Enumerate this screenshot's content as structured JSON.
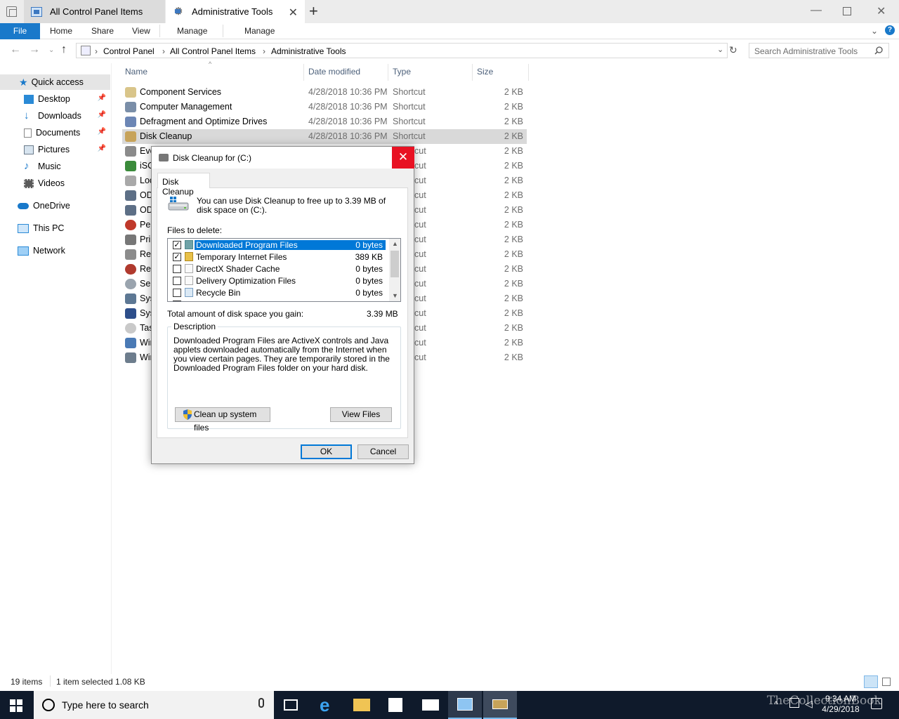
{
  "window": {
    "tabs": [
      {
        "label": "All Control Panel Items"
      },
      {
        "label": "Administrative Tools"
      }
    ]
  },
  "ribbon": {
    "file": "File",
    "tabs": [
      "Home",
      "Share",
      "View",
      "Manage",
      "Manage"
    ]
  },
  "address": {
    "crumbs": [
      "Control Panel",
      "All Control Panel Items",
      "Administrative Tools"
    ],
    "search_placeholder": "Search Administrative Tools"
  },
  "nav": {
    "items": [
      {
        "label": "Quick access",
        "icon": "star-icon"
      },
      {
        "label": "Desktop",
        "icon": "desktop-icon"
      },
      {
        "label": "Downloads",
        "icon": "download-icon"
      },
      {
        "label": "Documents",
        "icon": "documents-icon"
      },
      {
        "label": "Pictures",
        "icon": "pictures-icon"
      },
      {
        "label": "Music",
        "icon": "music-icon"
      },
      {
        "label": "Videos",
        "icon": "videos-icon"
      },
      {
        "label": "OneDrive",
        "icon": "cloud-icon"
      },
      {
        "label": "This PC",
        "icon": "computer-icon"
      },
      {
        "label": "Network",
        "icon": "network-icon"
      }
    ]
  },
  "list": {
    "headers": {
      "name": "Name",
      "date": "Date modified",
      "type": "Type",
      "size": "Size"
    },
    "rows": [
      {
        "name": "Component Services",
        "date": "4/28/2018 10:36 PM",
        "type": "Shortcut",
        "size": "2 KB"
      },
      {
        "name": "Computer Management",
        "date": "4/28/2018 10:36 PM",
        "type": "Shortcut",
        "size": "2 KB"
      },
      {
        "name": "Defragment and Optimize Drives",
        "date": "4/28/2018 10:36 PM",
        "type": "Shortcut",
        "size": "2 KB"
      },
      {
        "name": "Disk Cleanup",
        "date": "4/28/2018 10:36 PM",
        "type": "Shortcut",
        "size": "2 KB"
      },
      {
        "name": "Eve",
        "type": "cut",
        "size": "2 KB"
      },
      {
        "name": "iSC",
        "type": "cut",
        "size": "2 KB"
      },
      {
        "name": "Loc",
        "type": "cut",
        "size": "2 KB"
      },
      {
        "name": "OD",
        "type": "cut",
        "size": "2 KB"
      },
      {
        "name": "OD",
        "type": "cut",
        "size": "2 KB"
      },
      {
        "name": "Per",
        "type": "cut",
        "size": "2 KB"
      },
      {
        "name": "Pri",
        "type": "cut",
        "size": "2 KB"
      },
      {
        "name": "Rec",
        "type": "cut",
        "size": "2 KB"
      },
      {
        "name": "Res",
        "type": "cut",
        "size": "2 KB"
      },
      {
        "name": "Ser",
        "type": "cut",
        "size": "2 KB"
      },
      {
        "name": "Sys",
        "type": "cut",
        "size": "2 KB"
      },
      {
        "name": "Sys",
        "type": "cut",
        "size": "2 KB"
      },
      {
        "name": "Tas",
        "type": "cut",
        "size": "2 KB"
      },
      {
        "name": "Wir",
        "type": "cut",
        "size": "2 KB"
      },
      {
        "name": "Wir",
        "type": "cut",
        "size": "2 KB"
      }
    ]
  },
  "dialog": {
    "title": "Disk Cleanup for  (C:)",
    "tab": "Disk Cleanup",
    "intro": "You can use Disk Cleanup to free up to 3.39 MB of disk space on  (C:).",
    "files_label": "Files to delete:",
    "files": [
      {
        "label": "Downloaded Program Files",
        "value": "0 bytes",
        "checked": true
      },
      {
        "label": "Temporary Internet Files",
        "value": "389 KB",
        "checked": true
      },
      {
        "label": "DirectX Shader Cache",
        "value": "0 bytes",
        "checked": false
      },
      {
        "label": "Delivery Optimization Files",
        "value": "0 bytes",
        "checked": false
      },
      {
        "label": "Recycle Bin",
        "value": "0 bytes",
        "checked": false
      }
    ],
    "total_label": "Total amount of disk space you gain:",
    "total_value": "3.39 MB",
    "description_label": "Description",
    "description": "Downloaded Program Files are ActiveX controls and Java applets downloaded automatically from the Internet when you view certain pages. They are temporarily stored in the Downloaded Program Files folder on your hard disk.",
    "clean_button": "Clean up system files",
    "view_button": "View Files",
    "ok": "OK",
    "cancel": "Cancel"
  },
  "status": {
    "count": "19 items",
    "selection": "1 item selected  1.08 KB"
  },
  "taskbar": {
    "search_placeholder": "Type here to search",
    "time": "9:34 AM",
    "date": "4/29/2018",
    "watermark": "TheCollectionBook"
  },
  "colors": {
    "accent": "#0078d7",
    "close_red": "#e81123",
    "file_tab": "#1979ca",
    "taskbar": "#0f1a2b"
  }
}
